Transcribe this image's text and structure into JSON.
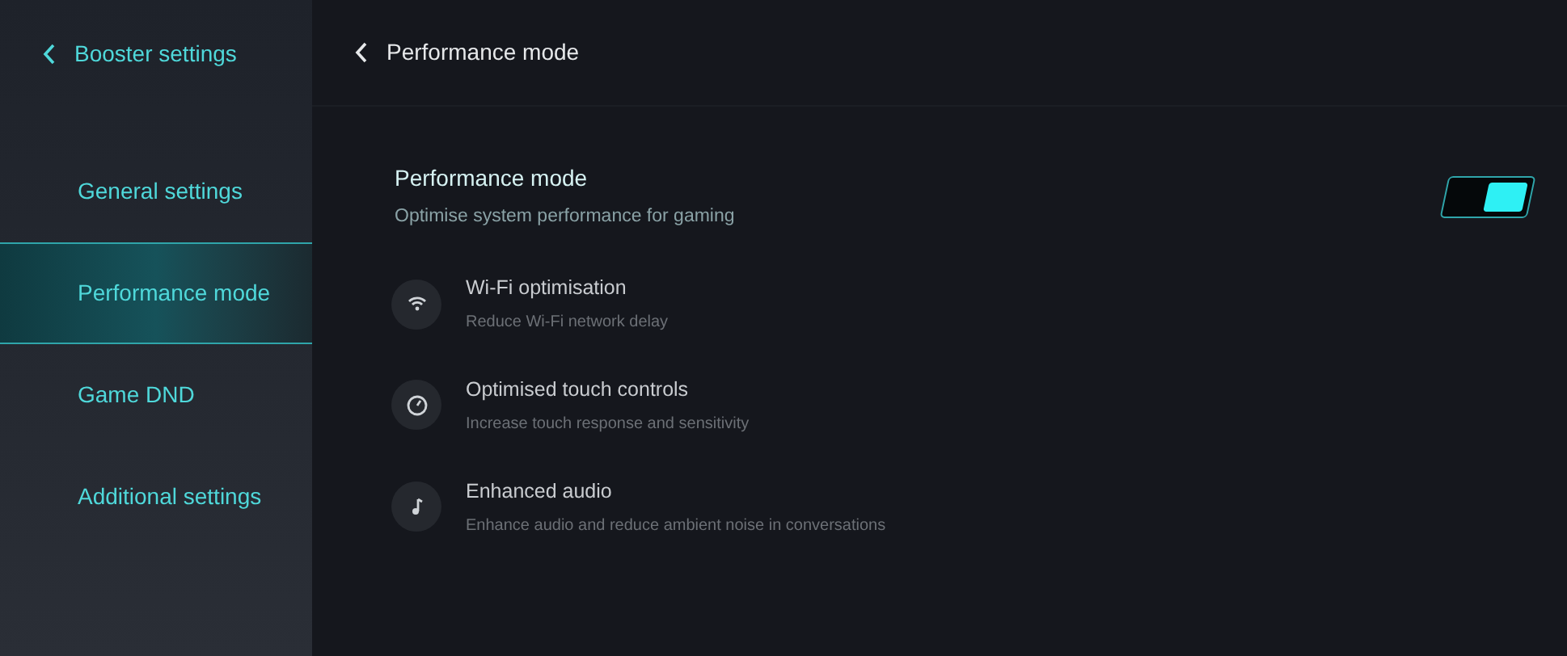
{
  "sidebar": {
    "back_title": "Booster settings",
    "items": [
      {
        "label": "General settings",
        "selected": false
      },
      {
        "label": "Performance mode",
        "selected": true
      },
      {
        "label": "Game DND",
        "selected": false
      },
      {
        "label": "Additional settings",
        "selected": false
      }
    ]
  },
  "header": {
    "title": "Performance mode"
  },
  "main_setting": {
    "title": "Performance mode",
    "subtitle": "Optimise system performance for gaming",
    "on": true
  },
  "features": [
    {
      "kind": "wifi",
      "title": "Wi-Fi optimisation",
      "subtitle": "Reduce Wi-Fi network delay"
    },
    {
      "kind": "touch",
      "title": "Optimised touch controls",
      "subtitle": "Increase touch response and sensitivity"
    },
    {
      "kind": "audio",
      "title": "Enhanced audio",
      "subtitle": "Enhance audio and reduce ambient noise in conversations"
    }
  ]
}
